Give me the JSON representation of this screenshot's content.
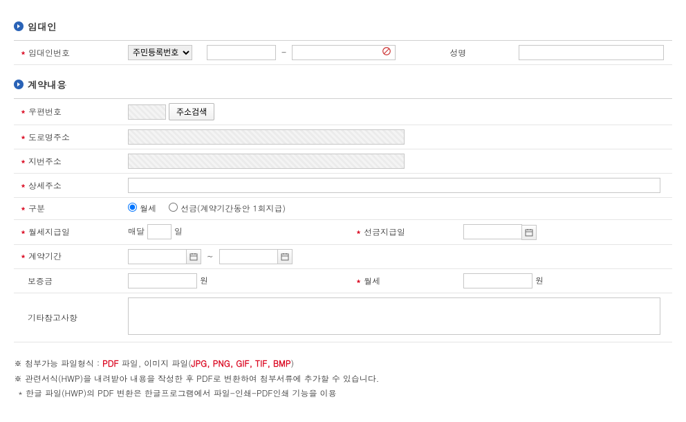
{
  "section1": {
    "title": "임대인"
  },
  "landlord": {
    "number_label": "임대인번호",
    "select": "주민등록번호",
    "name_label": "성명"
  },
  "section2": {
    "title": "계약내용"
  },
  "contract": {
    "zip_label": "우편번호",
    "addr_search_btn": "주소검색",
    "road_addr_label": "도로명주소",
    "lot_addr_label": "지번주소",
    "detail_addr_label": "상세주소",
    "type_label": "구분",
    "type_monthly": "월세",
    "type_prepaid": "선금(계약기간동안 1회지급)",
    "pay_day_label": "월세지급일",
    "pay_day_prefix": "매달",
    "pay_day_suffix": "일",
    "prepaid_day_label": "선금지급일",
    "period_label": "계약기간",
    "period_sep": "~",
    "deposit_label": "보증금",
    "won": "원",
    "monthly_label": "월세",
    "notes_label": "기타참고사항"
  },
  "footer": {
    "line1_a": "※ 첨부가능 파일형식 : ",
    "line1_b": "PDF",
    "line1_c": " 파일, 이미지 파일(",
    "line1_d": "JPG, PNG, GIF, TIF, BMP",
    "line1_e": ")",
    "line2": "※ 관련서식(HWP)을 내려받아 내용을 작성한 후 PDF로 변환하여 첨부서류에 추가할 수 있습니다.",
    "line3": "  * 한글 파일(HWP)의 PDF 변환은 한글프로그램에서 파일-인쇄-PDF인쇄 기능을 이용"
  }
}
